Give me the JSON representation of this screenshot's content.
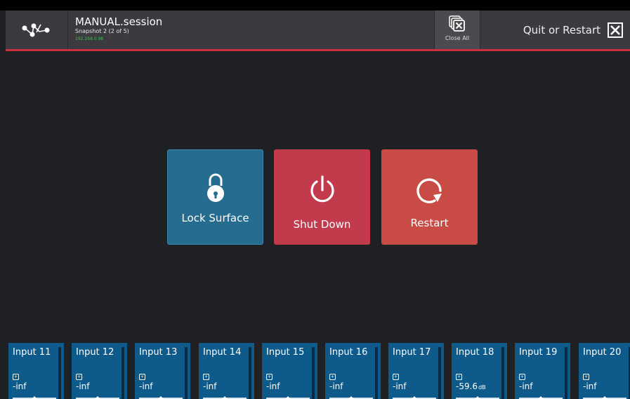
{
  "header": {
    "session_title": "MANUAL.session",
    "snapshot": "Snapshot 2 (2 of 5)",
    "ip": "192.168.0.98",
    "close_all_label": "Close All",
    "quit_label": "Quit or Restart",
    "accent_color": "#c8323f"
  },
  "actions": {
    "lock_label": "Lock Surface",
    "shutdown_label": "Shut Down",
    "restart_label": "Restart"
  },
  "channels": [
    {
      "name": "Input 11",
      "level": "-inf",
      "unit": ""
    },
    {
      "name": "Input 12",
      "level": "-inf",
      "unit": ""
    },
    {
      "name": "Input 13",
      "level": "-inf",
      "unit": ""
    },
    {
      "name": "Input 14",
      "level": "-inf",
      "unit": ""
    },
    {
      "name": "Input 15",
      "level": "-inf",
      "unit": ""
    },
    {
      "name": "Input 16",
      "level": "-inf",
      "unit": ""
    },
    {
      "name": "Input 17",
      "level": "-inf",
      "unit": ""
    },
    {
      "name": "Input 18",
      "level": "-59.6",
      "unit": "dB"
    },
    {
      "name": "Input 19",
      "level": "-inf",
      "unit": ""
    },
    {
      "name": "Input 20",
      "level": "-inf",
      "unit": ""
    }
  ]
}
